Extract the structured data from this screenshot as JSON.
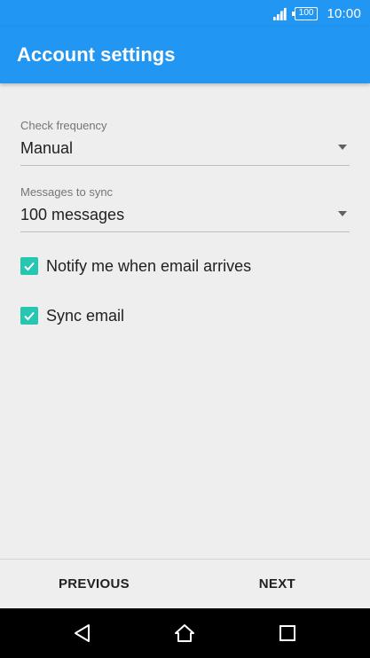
{
  "status_bar": {
    "battery_level": "100",
    "time": "10:00",
    "icons": [
      "signal-icon",
      "battery-icon"
    ]
  },
  "app_bar": {
    "title": "Account settings",
    "color": "#2196f3"
  },
  "form": {
    "check_frequency": {
      "label": "Check frequency",
      "value": "Manual"
    },
    "messages_to_sync": {
      "label": "Messages to sync",
      "value": "100 messages"
    },
    "notify": {
      "label": "Notify me when email arrives",
      "checked": true
    },
    "sync_email": {
      "label": "Sync email",
      "checked": true
    },
    "checkbox_color": "#26c6b0"
  },
  "buttons": {
    "previous": "PREVIOUS",
    "next": "NEXT"
  },
  "nav_bar": {
    "icons": [
      "back-icon",
      "home-icon",
      "recents-icon"
    ]
  }
}
